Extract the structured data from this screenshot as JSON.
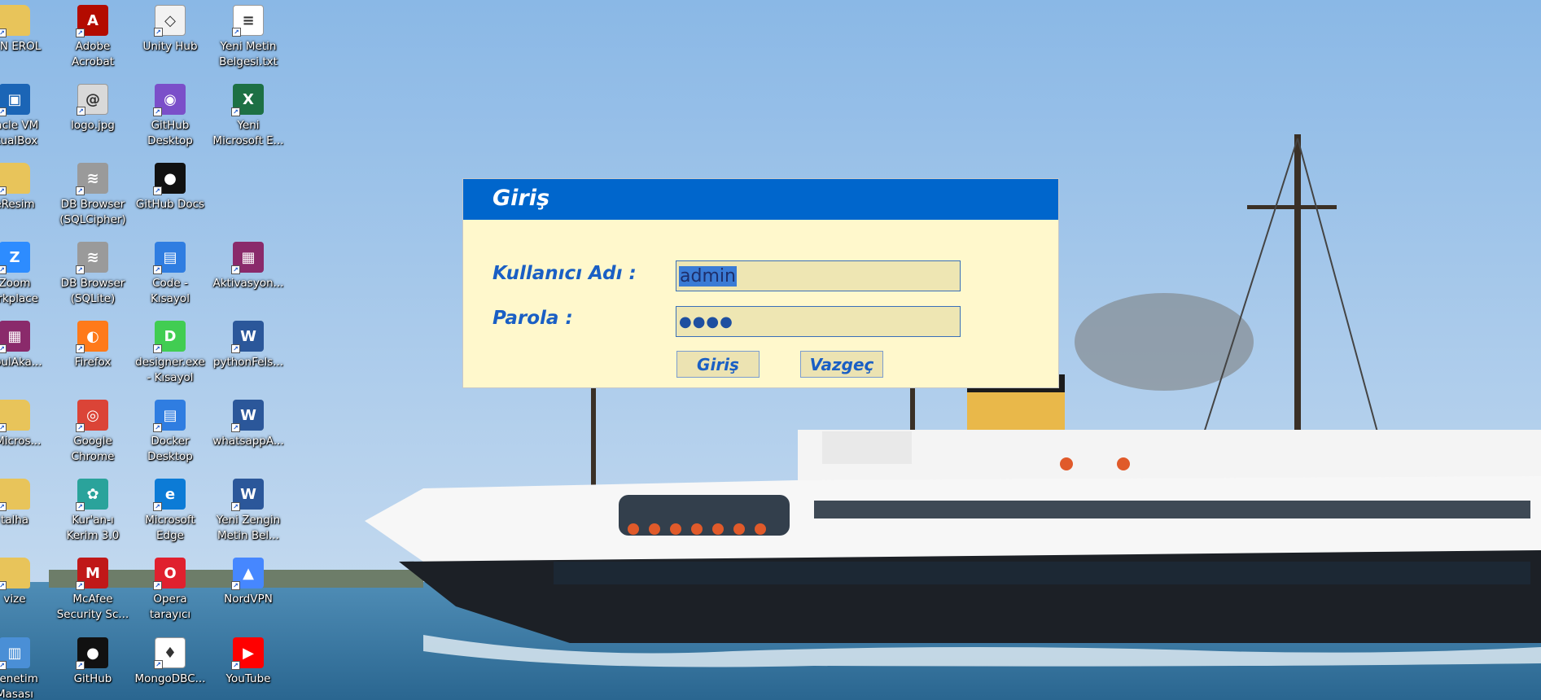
{
  "desktop": {
    "icons": [
      {
        "label": "HIN EROL",
        "icon": "folder-icon",
        "color": "#e8c45a"
      },
      {
        "label": "Adobe\nAcrobat",
        "icon": "adobe-acrobat-icon",
        "color": "#b30b00"
      },
      {
        "label": "Unity Hub",
        "icon": "unity-icon",
        "color": "#f2f2f2"
      },
      {
        "label": "Yeni Metin\nBelgesi.txt",
        "icon": "text-file-icon",
        "color": "#ffffff"
      },
      {
        "label": "racle VM\nrtualBox",
        "icon": "virtualbox-icon",
        "color": "#1b65b6"
      },
      {
        "label": "logo.jpg",
        "icon": "image-file-icon",
        "color": "#d9d9d9"
      },
      {
        "label": "GitHub\nDesktop",
        "icon": "github-desktop-icon",
        "color": "#7b4fc9"
      },
      {
        "label": "Yeni\nMicrosoft E...",
        "icon": "excel-icon",
        "color": "#1d7044"
      },
      {
        "label": "eResim",
        "icon": "folder-icon",
        "color": "#e8c45a"
      },
      {
        "label": "DB Browser\n(SQLCipher)",
        "icon": "database-icon",
        "color": "#9a9a9a"
      },
      {
        "label": "GitHub Docs",
        "icon": "github-icon",
        "color": "#111111"
      },
      {
        "label": "",
        "icon": "",
        "color": ""
      },
      {
        "label": "Zoom\norkplace",
        "icon": "zoom-icon",
        "color": "#2d8cff"
      },
      {
        "label": "DB Browser\n(SQLite)",
        "icon": "database-icon",
        "color": "#9a9a9a"
      },
      {
        "label": "Code -\nKısayol",
        "icon": "shortcut-file-icon",
        "color": "#2f7de1"
      },
      {
        "label": "Aktivasyon...",
        "icon": "archive-icon",
        "color": "#8a2a6b"
      },
      {
        "label": "nbulAka...",
        "icon": "archive-icon",
        "color": "#8a2a6b"
      },
      {
        "label": "Firefox",
        "icon": "firefox-icon",
        "color": "#ff7a1a"
      },
      {
        "label": "designer.exe\n- Kısayol",
        "icon": "designer-icon",
        "color": "#41cd52"
      },
      {
        "label": "pythonFels...",
        "icon": "word-icon",
        "color": "#2b579a"
      },
      {
        "label": "nMicros...",
        "icon": "folder-icon",
        "color": "#e8c45a"
      },
      {
        "label": "Google\nChrome",
        "icon": "chrome-icon",
        "color": "#db4437"
      },
      {
        "label": "Docker\nDesktop",
        "icon": "shortcut-file-icon",
        "color": "#2f7de1"
      },
      {
        "label": "whatsappA...",
        "icon": "word-icon",
        "color": "#2b579a"
      },
      {
        "label": "talha",
        "icon": "folder-icon",
        "color": "#e8c45a"
      },
      {
        "label": "Kur'an-ı\nKerim 3.0",
        "icon": "quran-icon",
        "color": "#2aa39b"
      },
      {
        "label": "Microsoft\nEdge",
        "icon": "edge-icon",
        "color": "#0c7bd6"
      },
      {
        "label": "Yeni Zengin\nMetin Bel...",
        "icon": "word-icon",
        "color": "#2b579a"
      },
      {
        "label": "vize",
        "icon": "folder-icon",
        "color": "#e8c45a"
      },
      {
        "label": "McAfee\nSecurity Sc...",
        "icon": "mcafee-icon",
        "color": "#c01818"
      },
      {
        "label": "Opera\ntarayıcı",
        "icon": "opera-icon",
        "color": "#e0202e"
      },
      {
        "label": "NordVPN",
        "icon": "nordvpn-icon",
        "color": "#4687ff"
      },
      {
        "label": "Denetim\nMasası",
        "icon": "control-panel-icon",
        "color": "#4a8fd6"
      },
      {
        "label": "GitHub",
        "icon": "github-icon",
        "color": "#111111"
      },
      {
        "label": "MongoDBC...",
        "icon": "mongodb-icon",
        "color": "#ffffff"
      },
      {
        "label": "YouTube",
        "icon": "youtube-icon",
        "color": "#ff0000"
      }
    ]
  },
  "dialog": {
    "title": "Giriş",
    "username_label": "Kullanıcı Adı :",
    "username_value": "admin",
    "password_label": "Parola :",
    "password_mask": "●●●●",
    "login_button": "Giriş",
    "cancel_button": "Vazgeç",
    "title_color": "#0066cc",
    "body_color": "#fff8cc"
  }
}
